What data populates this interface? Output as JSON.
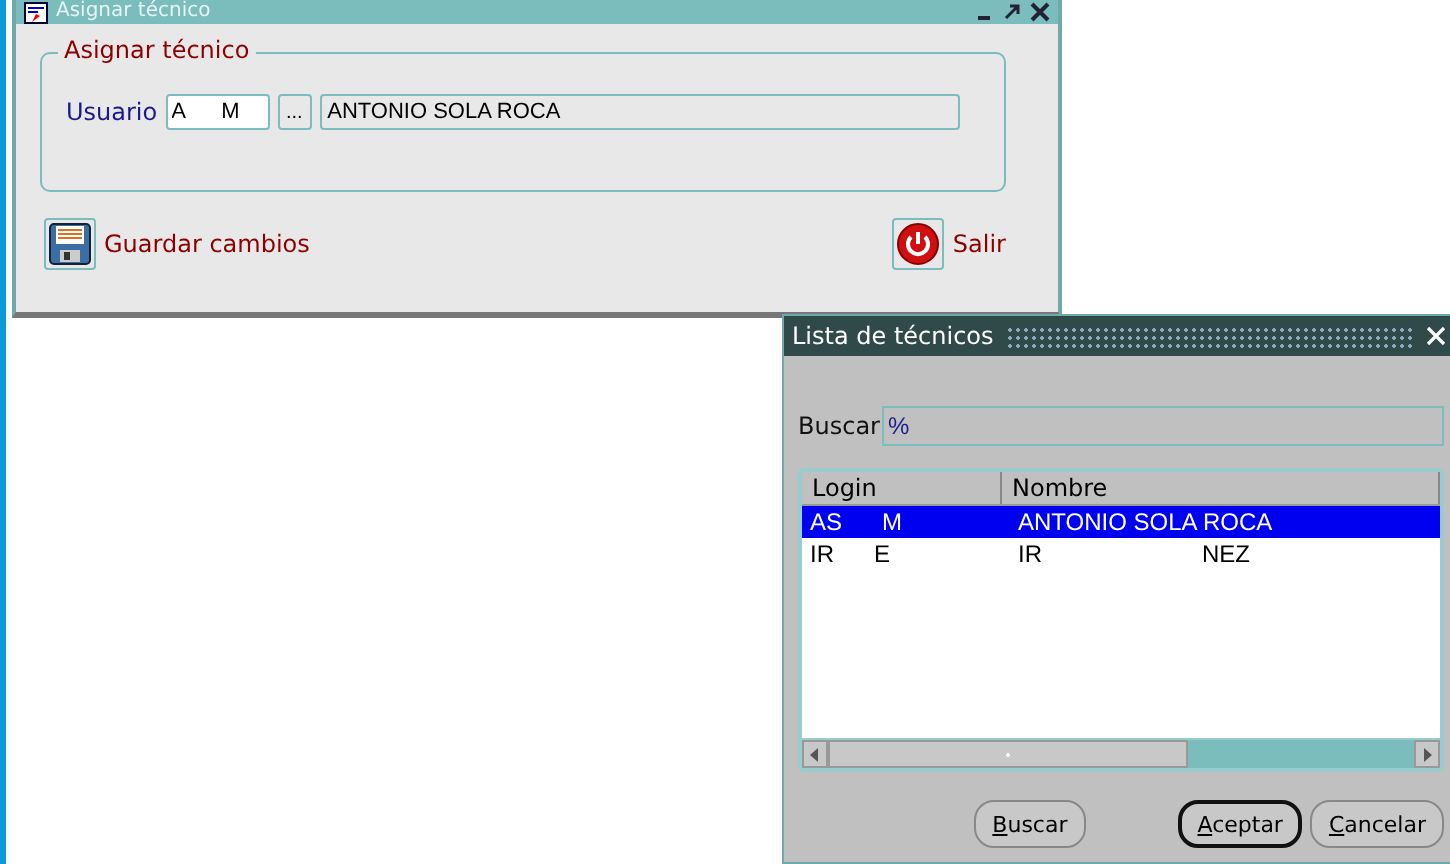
{
  "main_window": {
    "title": "Asignar técnico",
    "group": {
      "title": "Asignar técnico",
      "field_label": "Usuario",
      "login_value": "A      M",
      "lookup_button": "...",
      "name_value": "ANTONIO SOLA ROCA"
    },
    "buttons": [
      {
        "kind": "save",
        "label": "Guardar cambios"
      },
      {
        "kind": "exit",
        "label": "Salir"
      }
    ]
  },
  "dialog": {
    "title": "Lista de técnicos",
    "search": {
      "label": "Buscar",
      "value": "%"
    },
    "table": {
      "columns": [
        "Login",
        "Nombre"
      ],
      "rows": [
        {
          "cells": [
            "AS      M",
            "ANTONIO SOLA ROCA"
          ],
          "selected": true
        },
        {
          "cells": [
            "IR      E",
            "IR                        NEZ"
          ],
          "selected": false
        }
      ]
    },
    "buttons": [
      {
        "label": "Buscar",
        "default": false
      },
      {
        "label": "Aceptar",
        "default": true
      },
      {
        "label": "Cancelar",
        "default": false
      }
    ]
  }
}
